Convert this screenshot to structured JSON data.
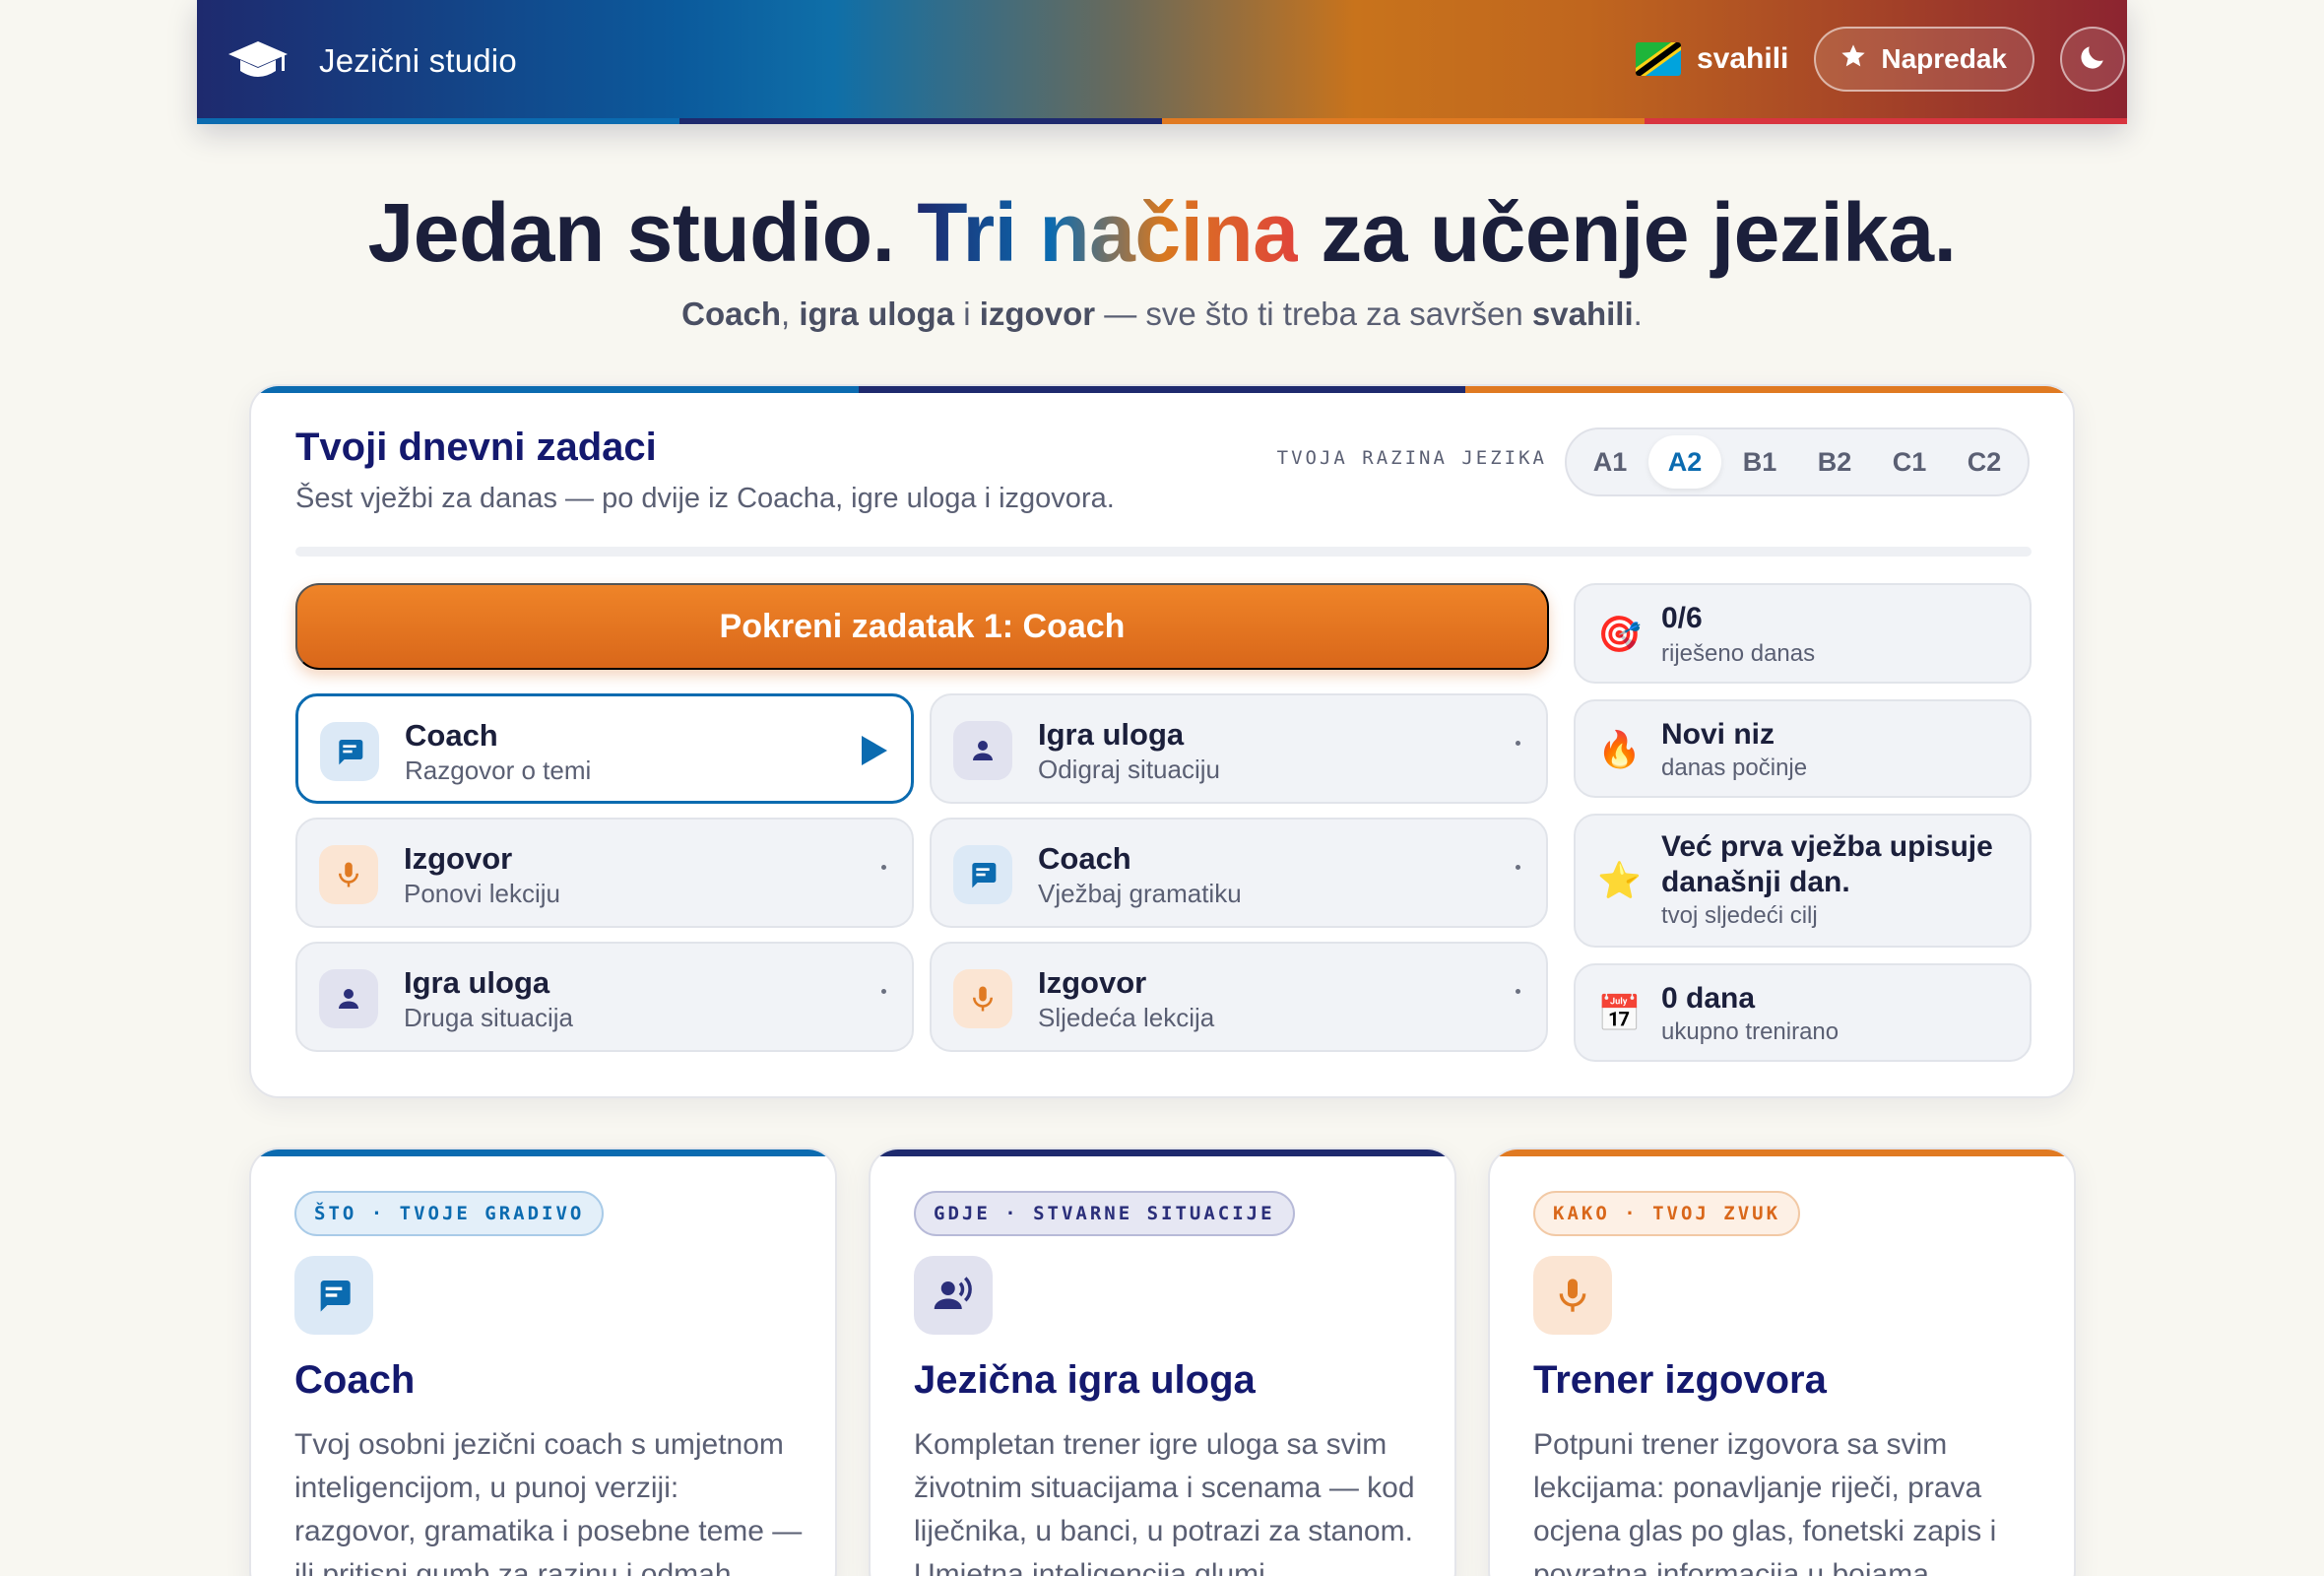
{
  "colors": {
    "blue": "#0b6bb0",
    "navy": "#1e2a6e",
    "orange": "#e07a22",
    "red": "#d8343f",
    "title_navy": "#14196e"
  },
  "header": {
    "title": "Jezični studio",
    "brand_icon": "graduation-cap-icon",
    "language": "svahili",
    "progress_label": "Napredak",
    "progress_icon": "star-icon",
    "theme_icon": "moon-icon"
  },
  "hero": {
    "title_a": "Jedan studio. ",
    "title_grad": "Tri načina",
    "title_b": " za učenje jezika.",
    "sub_1": "Coach",
    "sub_2": ", ",
    "sub_3": "igra uloga",
    "sub_4": " i ",
    "sub_5": "izgovor",
    "sub_6": " — sve što ti treba za savršen ",
    "sub_7": "svahili",
    "sub_8": "."
  },
  "tasks": {
    "title": "Tvoji dnevni zadaci",
    "subtitle": "Šest vježbi za danas — po dvije iz Coacha, igre uloga i izgovora.",
    "level_label": "TVOJA RAZINA JEZIKA",
    "levels": [
      "A1",
      "A2",
      "B1",
      "B2",
      "C1",
      "C2"
    ],
    "selected_level": "A2",
    "progress_fraction": 0,
    "start_button": "Pokreni zadatak 1: Coach",
    "items": [
      {
        "name": "Coach",
        "desc": "Razgovor o temi"
      },
      {
        "name": "Igra uloga",
        "desc": "Odigraj situaciju"
      },
      {
        "name": "Izgovor",
        "desc": "Ponovi lekciju"
      },
      {
        "name": "Coach",
        "desc": "Vježbaj gramatiku"
      },
      {
        "name": "Igra uloga",
        "desc": "Druga situacija"
      },
      {
        "name": "Izgovor",
        "desc": "Sljedeća lekcija"
      }
    ],
    "stats": [
      {
        "emoji": "🎯",
        "title": "0/6",
        "sub": "riješeno danas"
      },
      {
        "emoji": "🔥",
        "title": "Novi niz",
        "sub": "danas počinje"
      },
      {
        "emoji": "⭐",
        "title": "Već prva vježba upisuje današnji dan.",
        "sub": "tvoj sljedeći cilj"
      },
      {
        "emoji": "📅",
        "title": "0 dana",
        "sub": "ukupno trenirano"
      }
    ]
  },
  "features": [
    {
      "tag": "ŠTO · TVOJE GRADIVO",
      "title": "Coach",
      "text": "Tvoj osobni jezični coach s umjetnom inteligencijom, u punoj verziji: razgovor, gramatika i posebne teme — ili pritisni gumb za razinu i odmah",
      "icon": "chat-bubble-icon"
    },
    {
      "tag": "GDJE · STVARNE SITUACIJE",
      "title": "Jezična igra uloga",
      "text": "Kompletan trener igre uloga sa svim životnim situacijama i scenama — kod liječnika, u banci, u potrazi za stanom. Umjetna inteligencija glumi",
      "icon": "speaking-person-icon"
    },
    {
      "tag": "KAKO · TVOJ ZVUK",
      "title": "Trener izgovora",
      "text": "Potpuni trener izgovora sa svim lekcijama: ponavljanje riječi, prava ocjena glas po glas, fonetski zapis i povratna informacija u bojama",
      "icon": "microphone-icon"
    }
  ]
}
